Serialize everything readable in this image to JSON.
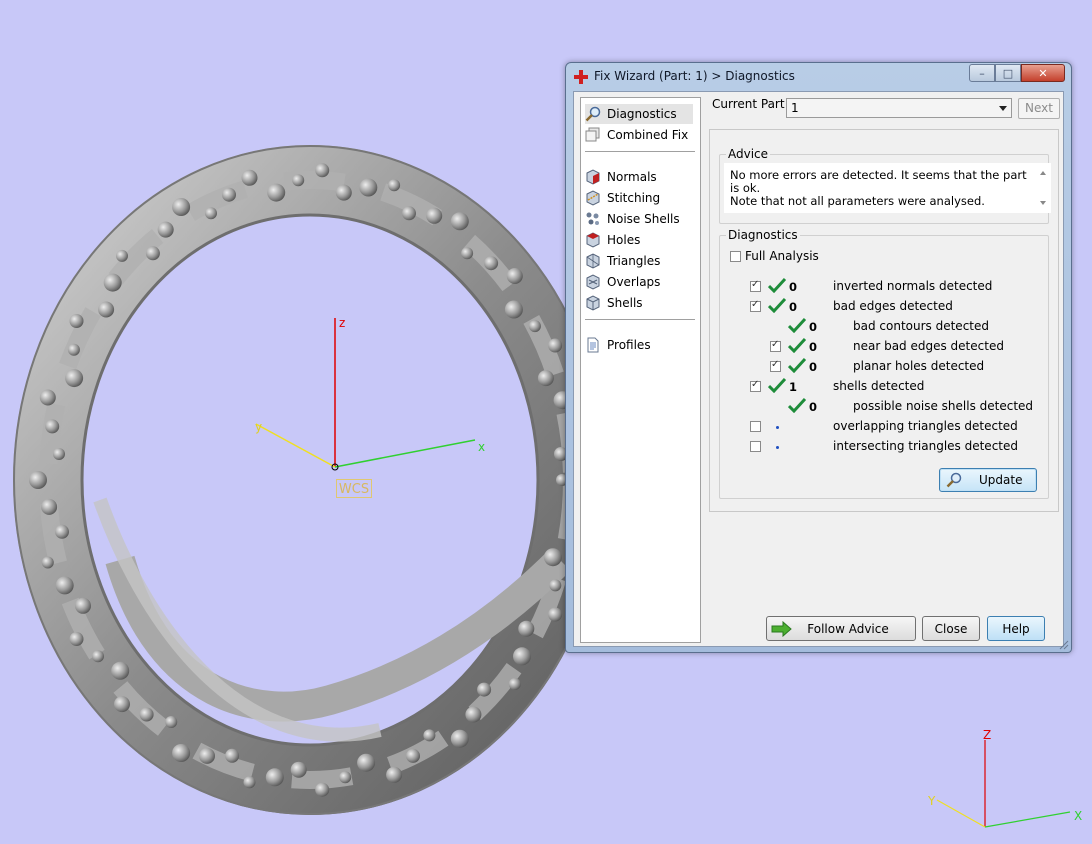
{
  "window": {
    "title": "Fix Wizard (Part: 1) > Diagnostics",
    "buttons": {
      "minimize": "–",
      "maximize": "□",
      "close": "✕"
    }
  },
  "viewport": {
    "wcs_label": "WCS",
    "axes": {
      "x": "x",
      "y": "y",
      "z": "z"
    },
    "corner_axes": {
      "x": "X",
      "y": "Y",
      "z": "Z"
    }
  },
  "nav": {
    "items_top": [
      "Diagnostics",
      "Combined Fix"
    ],
    "items_mid": [
      "Normals",
      "Stitching",
      "Noise Shells",
      "Holes",
      "Triangles",
      "Overlaps",
      "Shells"
    ],
    "items_bottom": [
      "Profiles"
    ]
  },
  "header": {
    "current_part_label": "Current Part:",
    "current_part_value": "1",
    "next_label": "Next"
  },
  "advice": {
    "title": "Advice",
    "line1": "No more errors are detected. It seems that the part is ok.",
    "line2": "Note that not all parameters were analysed."
  },
  "diagnostics": {
    "title": "Diagnostics",
    "full_analysis_label": "Full Analysis",
    "rows": [
      {
        "count": "0",
        "label": "inverted normals detected"
      },
      {
        "count": "0",
        "label": "bad edges detected"
      },
      {
        "count": "0",
        "label": "bad contours detected"
      },
      {
        "count": "0",
        "label": "near bad edges detected"
      },
      {
        "count": "0",
        "label": "planar holes detected"
      },
      {
        "count": "1",
        "label": "shells detected"
      },
      {
        "count": "0",
        "label": "possible noise shells detected"
      },
      {
        "count": "",
        "label": "overlapping triangles detected"
      },
      {
        "count": "",
        "label": "intersecting triangles detected"
      }
    ],
    "update_label": "Update"
  },
  "footer": {
    "follow_advice_label": "Follow Advice",
    "close_label": "Close",
    "help_label": "Help"
  },
  "colors": {
    "viewport_bg": "#c8c8f8",
    "z_axis": "#e00000",
    "x_axis": "#30d030",
    "y_axis": "#f0e020",
    "check_green": "#1e8c3a"
  }
}
